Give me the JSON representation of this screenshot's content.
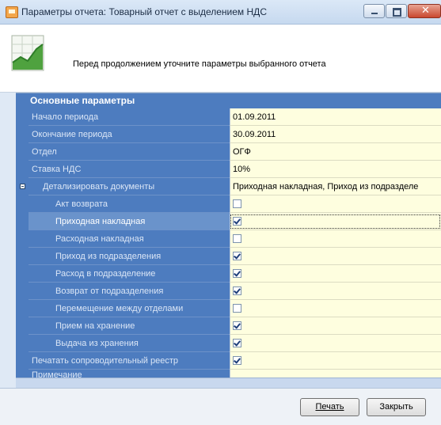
{
  "window": {
    "title": "Параметры отчета: Товарный отчет с выделением НДС"
  },
  "header": {
    "message": "Перед продолжением уточните параметры выбранного отчета"
  },
  "grid": {
    "category": "Основные параметры",
    "rows": [
      {
        "label": "Начало периода",
        "value": "01.09.2011"
      },
      {
        "label": "Окончание периода",
        "value": "30.09.2011"
      },
      {
        "label": "Отдел",
        "value": "ОГФ"
      },
      {
        "label": "Ставка НДС",
        "value": "10%"
      },
      {
        "label": "Детализировать документы",
        "value": "Приходная накладная, Приход из подразделе"
      }
    ],
    "details": [
      {
        "label": "Акт возврата",
        "checked": false
      },
      {
        "label": "Приходная накладная",
        "checked": true
      },
      {
        "label": "Расходная накладная",
        "checked": false
      },
      {
        "label": "Приход из подразделения",
        "checked": true
      },
      {
        "label": "Расход в подразделение",
        "checked": true
      },
      {
        "label": "Возврат от подразделения",
        "checked": true
      },
      {
        "label": "Перемещение между отделами",
        "checked": false
      },
      {
        "label": "Прием на хранение",
        "checked": true
      },
      {
        "label": "Выдача из хранения",
        "checked": true
      }
    ],
    "print_registry": {
      "label": "Печатать сопроводительный реестр",
      "checked": true
    },
    "note": {
      "label": "Примечание",
      "value": ""
    }
  },
  "footer": {
    "print_label": "Печать",
    "close_label": "Закрыть"
  },
  "colors": {
    "grid_label_bg": "#4d7cbf",
    "grid_value_bg": "#fefedf"
  }
}
